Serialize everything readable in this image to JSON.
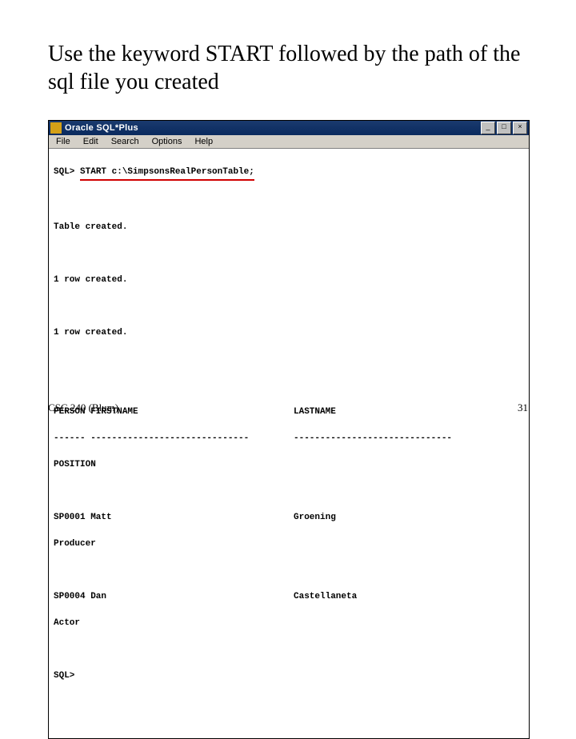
{
  "heading": "Use the keyword START followed by the path of the sql file you created",
  "window": {
    "title": "Oracle SQL*Plus",
    "controls": {
      "min": "_",
      "max": "□",
      "close": "×"
    },
    "menu": [
      "File",
      "Edit",
      "Search",
      "Options",
      "Help"
    ]
  },
  "console": {
    "prompt1": "SQL> ",
    "command": "START c:\\SimpsonsRealPersonTable;",
    "msg_table": "Table created.",
    "msg_row1": "1 row created.",
    "msg_row2": "1 row created.",
    "hdr_person_first": "PERSON FIRSTNAME",
    "hdr_last": "LASTNAME",
    "hdr_dash_pf": "------ ------------------------------",
    "hdr_dash_last": "------------------------------",
    "hdr_position": "POSITION",
    "row1_a": "SP0001 Matt",
    "row1_b": "Groening",
    "row1_pos": "Producer",
    "row2_a": "SP0004 Dan",
    "row2_b": "Castellaneta",
    "row2_pos": "Actor",
    "prompt2": "SQL>"
  },
  "footer": {
    "left": "CSC 240 (Blum)",
    "right": "31"
  }
}
